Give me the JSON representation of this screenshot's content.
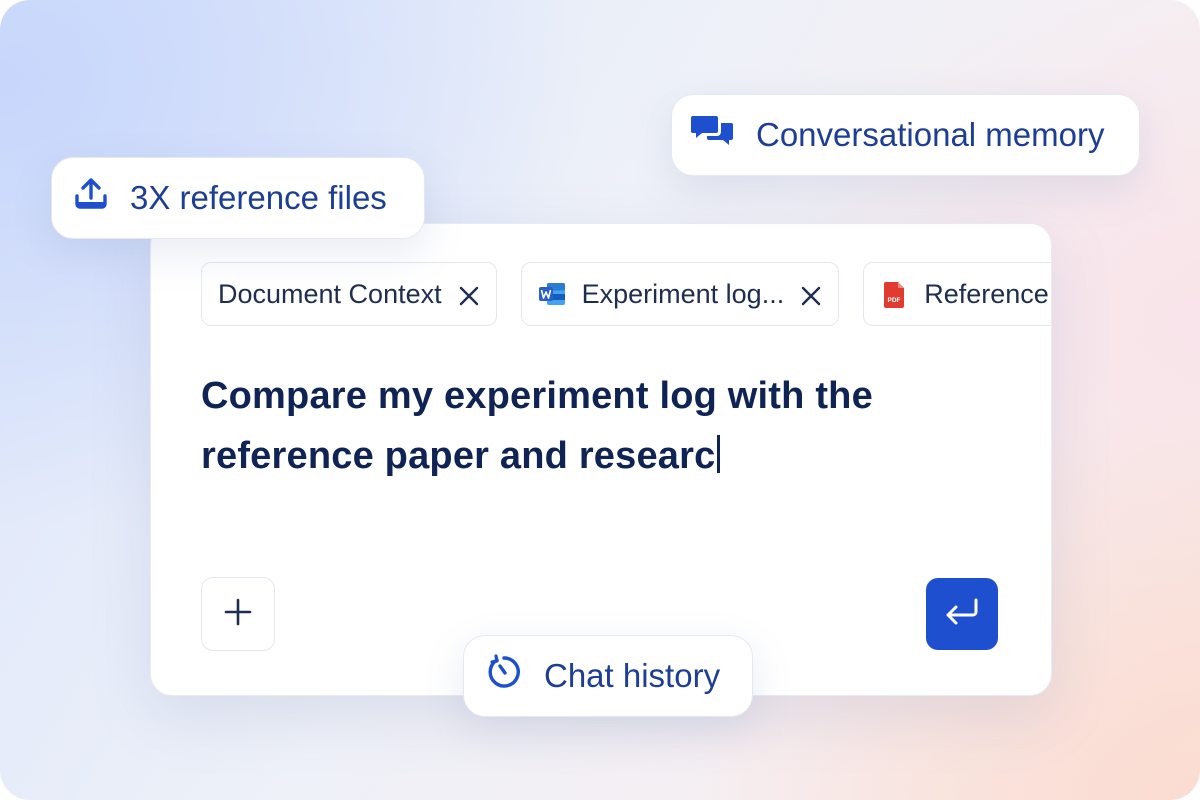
{
  "features": {
    "files": {
      "label": "3X reference files",
      "icon": "upload-icon"
    },
    "memory": {
      "label": "Conversational memory",
      "icon": "chat-bubbles-icon"
    },
    "history": {
      "label": "Chat history",
      "icon": "history-clock-icon"
    }
  },
  "composer": {
    "attachments": [
      {
        "label": "Document Context",
        "icon": null
      },
      {
        "label": "Experiment log...",
        "icon": "word-doc-icon"
      },
      {
        "label": "Reference",
        "icon": "pdf-icon"
      }
    ],
    "prompt_text": "Compare my experiment log with the reference paper and researc",
    "add_icon": "plus-icon",
    "send_icon": "enter-return-icon"
  },
  "colors": {
    "accent": "#1d4fcf",
    "heading": "#0f2354",
    "pill_text": "#1d3e96",
    "word_blue": "#2b5fc7",
    "pdf_red": "#e03a31"
  }
}
